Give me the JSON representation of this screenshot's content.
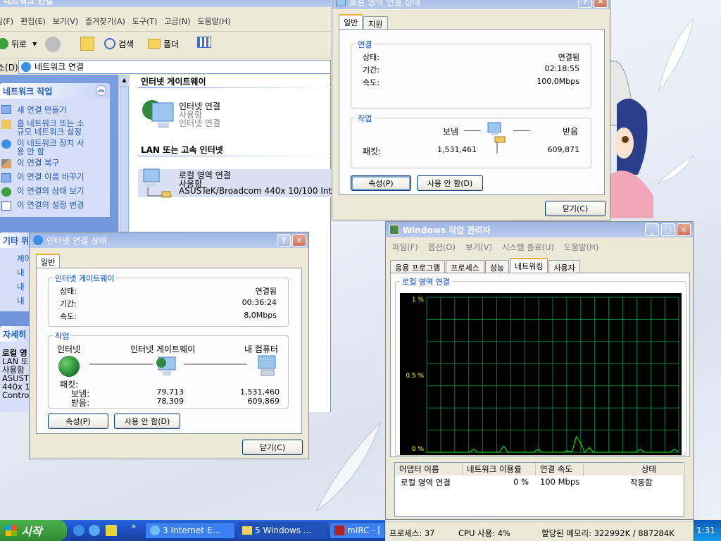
{
  "explorer": {
    "title": "네트워크 연결",
    "menu": [
      "일(F)",
      "편집(E)",
      "보기(V)",
      "즐겨찾기(A)",
      "도구(T)",
      "고급(N)",
      "도움말(H)"
    ],
    "toolbar": {
      "back": "뒤로",
      "search": "검색",
      "folders": "폴더"
    },
    "address_label": "소(D)",
    "address_value": "네트워크 연결",
    "tasks_title": "네트워크 작업",
    "tasks": [
      {
        "label": "새 연결 만들기"
      },
      {
        "label": "홈 네트워크 또는 소\n규모 네트워크 설정"
      },
      {
        "label": "이 네트워크 장치 사\n용 안 함"
      },
      {
        "label": "이 연결 복구"
      },
      {
        "label": "이 연결 이름 바꾸기"
      },
      {
        "label": "이 연결의 상태 보기"
      },
      {
        "label": "이 연결의 설정 변경"
      }
    ],
    "other_title": "기타 위",
    "other_items": [
      "제어",
      "내",
      "내",
      "내"
    ],
    "details_title": "자세히",
    "details_lines": [
      "로컬 영",
      "LAN 또",
      "사용함",
      "ASUST",
      "440x 1(",
      "Contro"
    ],
    "sections": {
      "internet_gateway": "인터넷 게이트웨이",
      "lan": "LAN 또는 고속 인터넷"
    },
    "items": {
      "internet": {
        "name": "인터넷 연결",
        "status": "사용함",
        "sub": "인터넷 연결"
      },
      "lan": {
        "name": "로컬 영역 연결",
        "status": "사용함",
        "device": "ASUSTeK/Broadcom 440x 10/100 Int..."
      }
    }
  },
  "lan_status": {
    "title": "로컬 영역 연결 상태",
    "tabs": [
      "일반",
      "지원"
    ],
    "connection_group": "연결",
    "status_label": "상태:",
    "status_value": "연결됨",
    "duration_label": "기간:",
    "duration_value": "02:18:55",
    "speed_label": "속도:",
    "speed_value": "100,0Mbps",
    "activity_group": "작업",
    "sent_label": "보냄",
    "received_label": "받음",
    "packets_label": "패킷:",
    "sent_value": "1,531,461",
    "received_value": "609,871",
    "properties_btn": "속성(P)",
    "disable_btn": "사용 안 함(D)",
    "close_btn": "닫기(C)"
  },
  "inet_status": {
    "title": "인터넷 연결 상태",
    "tab": "일반",
    "gateway_group": "인터넷 게이트웨이",
    "status_label": "상태:",
    "status_value": "연결됨",
    "duration_label": "기간:",
    "duration_value": "00:36:24",
    "speed_label": "속도:",
    "speed_value": "8,0Mbps",
    "activity_group": "작업",
    "col_internet": "인터넷",
    "col_gateway": "인터넷 게이트웨이",
    "col_computer": "내 컴퓨터",
    "packets_label": "패킷:",
    "sent_label": "보냄:",
    "received_label": "받음:",
    "gw_sent": "79,713",
    "gw_received": "78,309",
    "pc_sent": "1,531,460",
    "pc_received": "609,869",
    "properties_btn": "속성(P)",
    "disable_btn": "사용 안 함(D)",
    "close_btn": "닫기(C)"
  },
  "taskmgr": {
    "title": "Windows 작업 관리자",
    "menu": [
      "파일(F)",
      "옵션(O)",
      "보기(V)",
      "시스템 종료(U)",
      "도움말(H)"
    ],
    "tabs": [
      "응용 프로그램",
      "프로세스",
      "성능",
      "네트워킹",
      "사용자"
    ],
    "graph_title": "로컬 영역 연결",
    "y_labels": [
      "1 %",
      "0.5 %",
      "0 %"
    ],
    "columns": [
      "어댑터 이름",
      "네트워크 이용률",
      "연결 속도",
      "상태"
    ],
    "row": {
      "name": "로컬 영역 연결",
      "usage": "0 %",
      "speed": "100 Mbps",
      "state": "작동함"
    },
    "statusbar": {
      "processes": "프로세스: 37",
      "cpu": "CPU 사용: 4%",
      "memory": "할당된 메모리: 322992K / 887284K"
    }
  },
  "chart_data": {
    "type": "line",
    "title": "로컬 영역 연결",
    "ylim": [
      0,
      1
    ],
    "y_unit": "%",
    "x": [
      0,
      1,
      2,
      3,
      4,
      5,
      6,
      7,
      8,
      9,
      10,
      11,
      12,
      13,
      14,
      15,
      16,
      17,
      18,
      19,
      20,
      21,
      22,
      23,
      24,
      25,
      26,
      27,
      28,
      29,
      30,
      31,
      32,
      33,
      34,
      35,
      36,
      37,
      38,
      39,
      40,
      41,
      42,
      43,
      44,
      45,
      46,
      47,
      48,
      49,
      50,
      51,
      52,
      53,
      54,
      55,
      56,
      57,
      58,
      59
    ],
    "series": [
      {
        "values": [
          0,
          0,
          0,
          0,
          0,
          0,
          0,
          0,
          0,
          0,
          0,
          0.02,
          0,
          0,
          0,
          0,
          0,
          0,
          0.04,
          0,
          0,
          0,
          0,
          0,
          0,
          0,
          0.02,
          0,
          0,
          0,
          0,
          0,
          0,
          0.01,
          0,
          0.1,
          0.06,
          0,
          0.03,
          0,
          0,
          0,
          0,
          0,
          0,
          0,
          0,
          0,
          0,
          0,
          0.02,
          0,
          0,
          0,
          0,
          0,
          0,
          0,
          0.02,
          0
        ]
      }
    ],
    "grid": true
  },
  "taskbar": {
    "start": "시작",
    "tasks": [
      "3 Internet E...",
      "5 Windows ...",
      "mIRC - ["
    ],
    "clock": "1:31"
  },
  "colors": {
    "graph_line": "#00ff00",
    "grid": "#008040",
    "xp_blue": "#0a4fc4"
  }
}
